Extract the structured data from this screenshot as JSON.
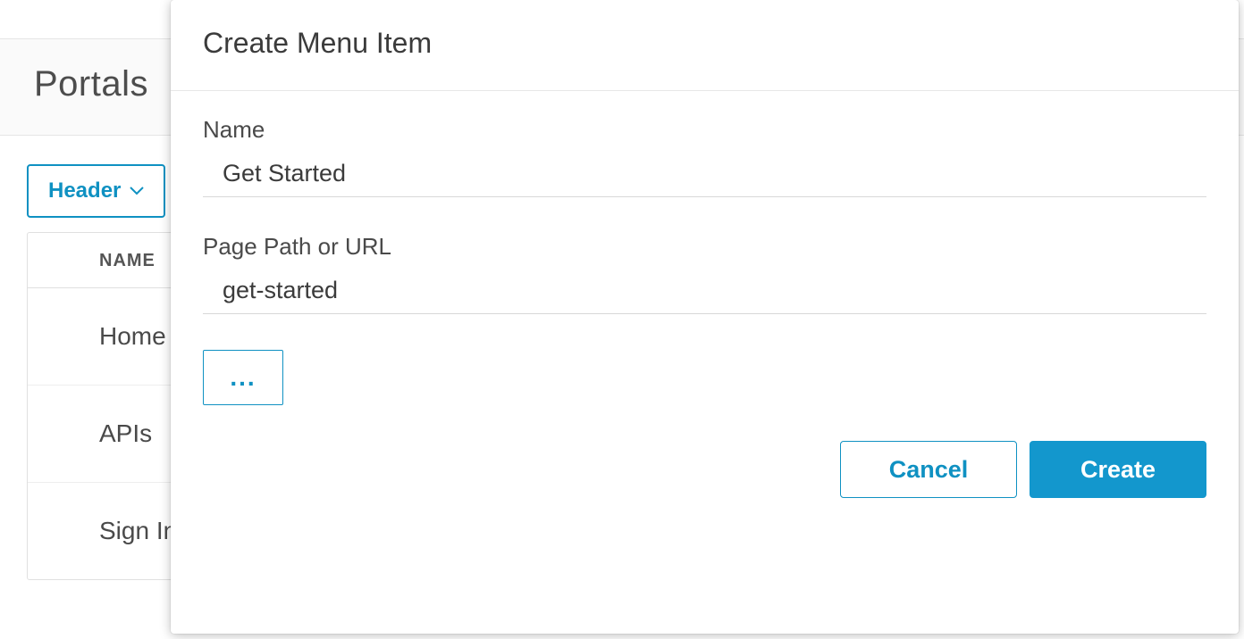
{
  "page": {
    "title": "Portals",
    "dropdown_label": "Header",
    "table": {
      "columns": [
        "NAME"
      ],
      "rows": [
        "Home",
        "APIs",
        "Sign In"
      ]
    }
  },
  "modal": {
    "title": "Create Menu Item",
    "fields": {
      "name": {
        "label": "Name",
        "value": "Get Started"
      },
      "path": {
        "label": "Page Path or URL",
        "value": "get-started"
      }
    },
    "more_label": "...",
    "buttons": {
      "cancel": "Cancel",
      "create": "Create"
    }
  }
}
